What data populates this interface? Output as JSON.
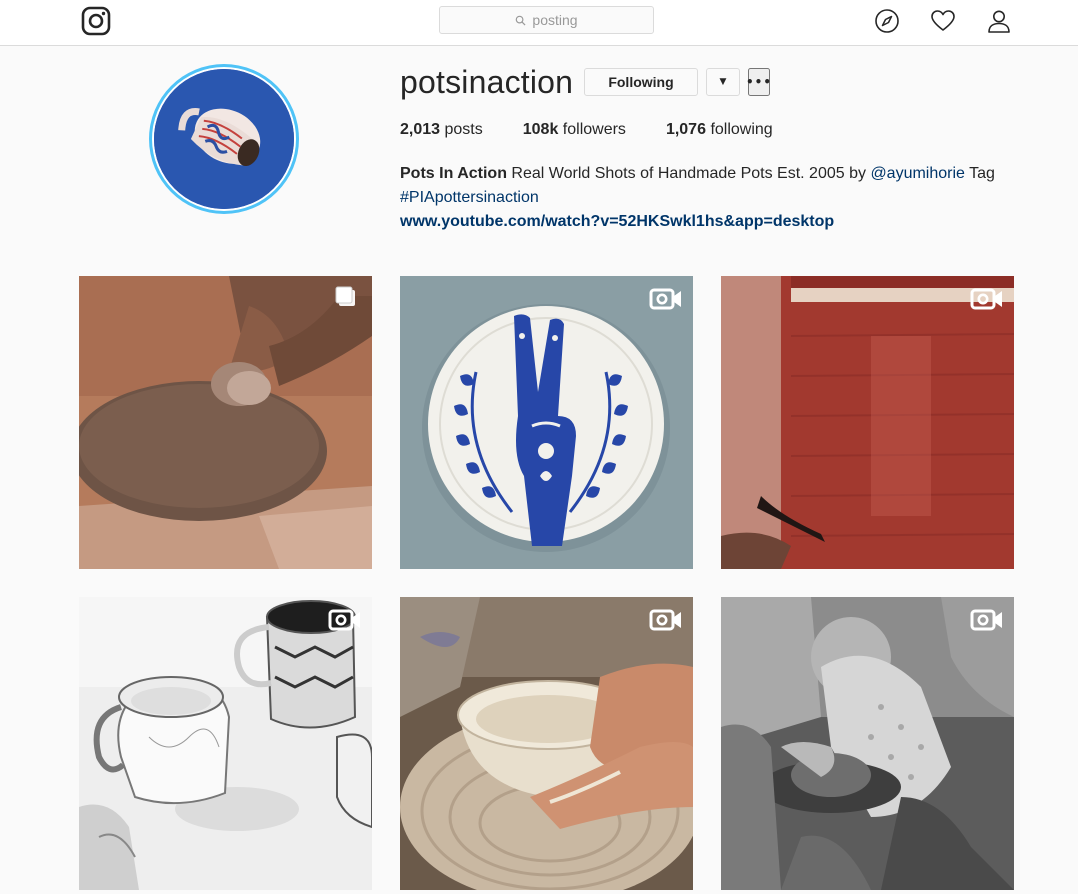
{
  "nav": {
    "search_placeholder": "posting",
    "icons": [
      "instagram-logo-icon",
      "search-icon",
      "compass-icon",
      "heart-icon",
      "user-icon"
    ]
  },
  "profile": {
    "username": "potsinaction",
    "following_button": "Following",
    "dropdown_glyph": "▼",
    "more_glyph": "•••",
    "stats": {
      "posts_count": "2,013",
      "posts_label": "posts",
      "followers_count": "108k",
      "followers_label": "followers",
      "following_count": "1,076",
      "following_label": "following"
    },
    "bio": {
      "name": "Pots In Action",
      "text": "Real World Shots of Handmade Pots Est. 2005 by",
      "mention": "@ayumihorie",
      "tag_word": "Tag",
      "hashtag": "#PIApottersinaction",
      "url": "www.youtube.com/watch?v=52HKSwkl1hs&app=desktop"
    }
  },
  "posts": [
    {
      "type": "carousel",
      "badge_icon": "multiple-posts-icon",
      "subject": "Hand rolling clay on dirt ground"
    },
    {
      "type": "video",
      "badge_icon": "video-icon",
      "subject": "Plate with blue peace-sign hand and leaves"
    },
    {
      "type": "video",
      "badge_icon": "video-icon",
      "subject": "Red pot being shaped with a tool"
    },
    {
      "type": "video",
      "badge_icon": "video-icon",
      "subject": "Black and white mugs"
    },
    {
      "type": "video",
      "badge_icon": "video-icon",
      "subject": "Hands throwing a bowl on the wheel"
    },
    {
      "type": "video",
      "badge_icon": "video-icon",
      "subject": "Vintage photo of potter at wheel"
    }
  ],
  "colors": {
    "link": "#003569",
    "border": "#dbdbdb",
    "background": "#fafafa",
    "avatar_ring": "#4fc3f7"
  }
}
